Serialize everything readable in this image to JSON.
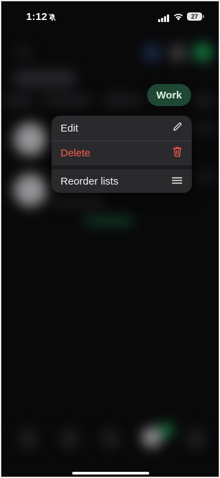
{
  "status_bar": {
    "time": "1:12",
    "battery": "27"
  },
  "chip": {
    "label": "Work"
  },
  "menu": {
    "edit_label": "Edit",
    "delete_label": "Delete",
    "reorder_label": "Reorder lists"
  },
  "icons": {
    "bell": "bell-slash-icon",
    "signal": "cellular-signal-icon",
    "wifi": "wifi-icon",
    "battery": "battery-icon",
    "edit": "pencil-icon",
    "delete": "trash-icon",
    "reorder": "reorder-lines-icon"
  },
  "colors": {
    "background": "#0c0c0e",
    "menu": "#2a2a2d",
    "delete": "#ff5a4f",
    "chip": "#1f4733",
    "chip_text": "#d9f2e2"
  }
}
